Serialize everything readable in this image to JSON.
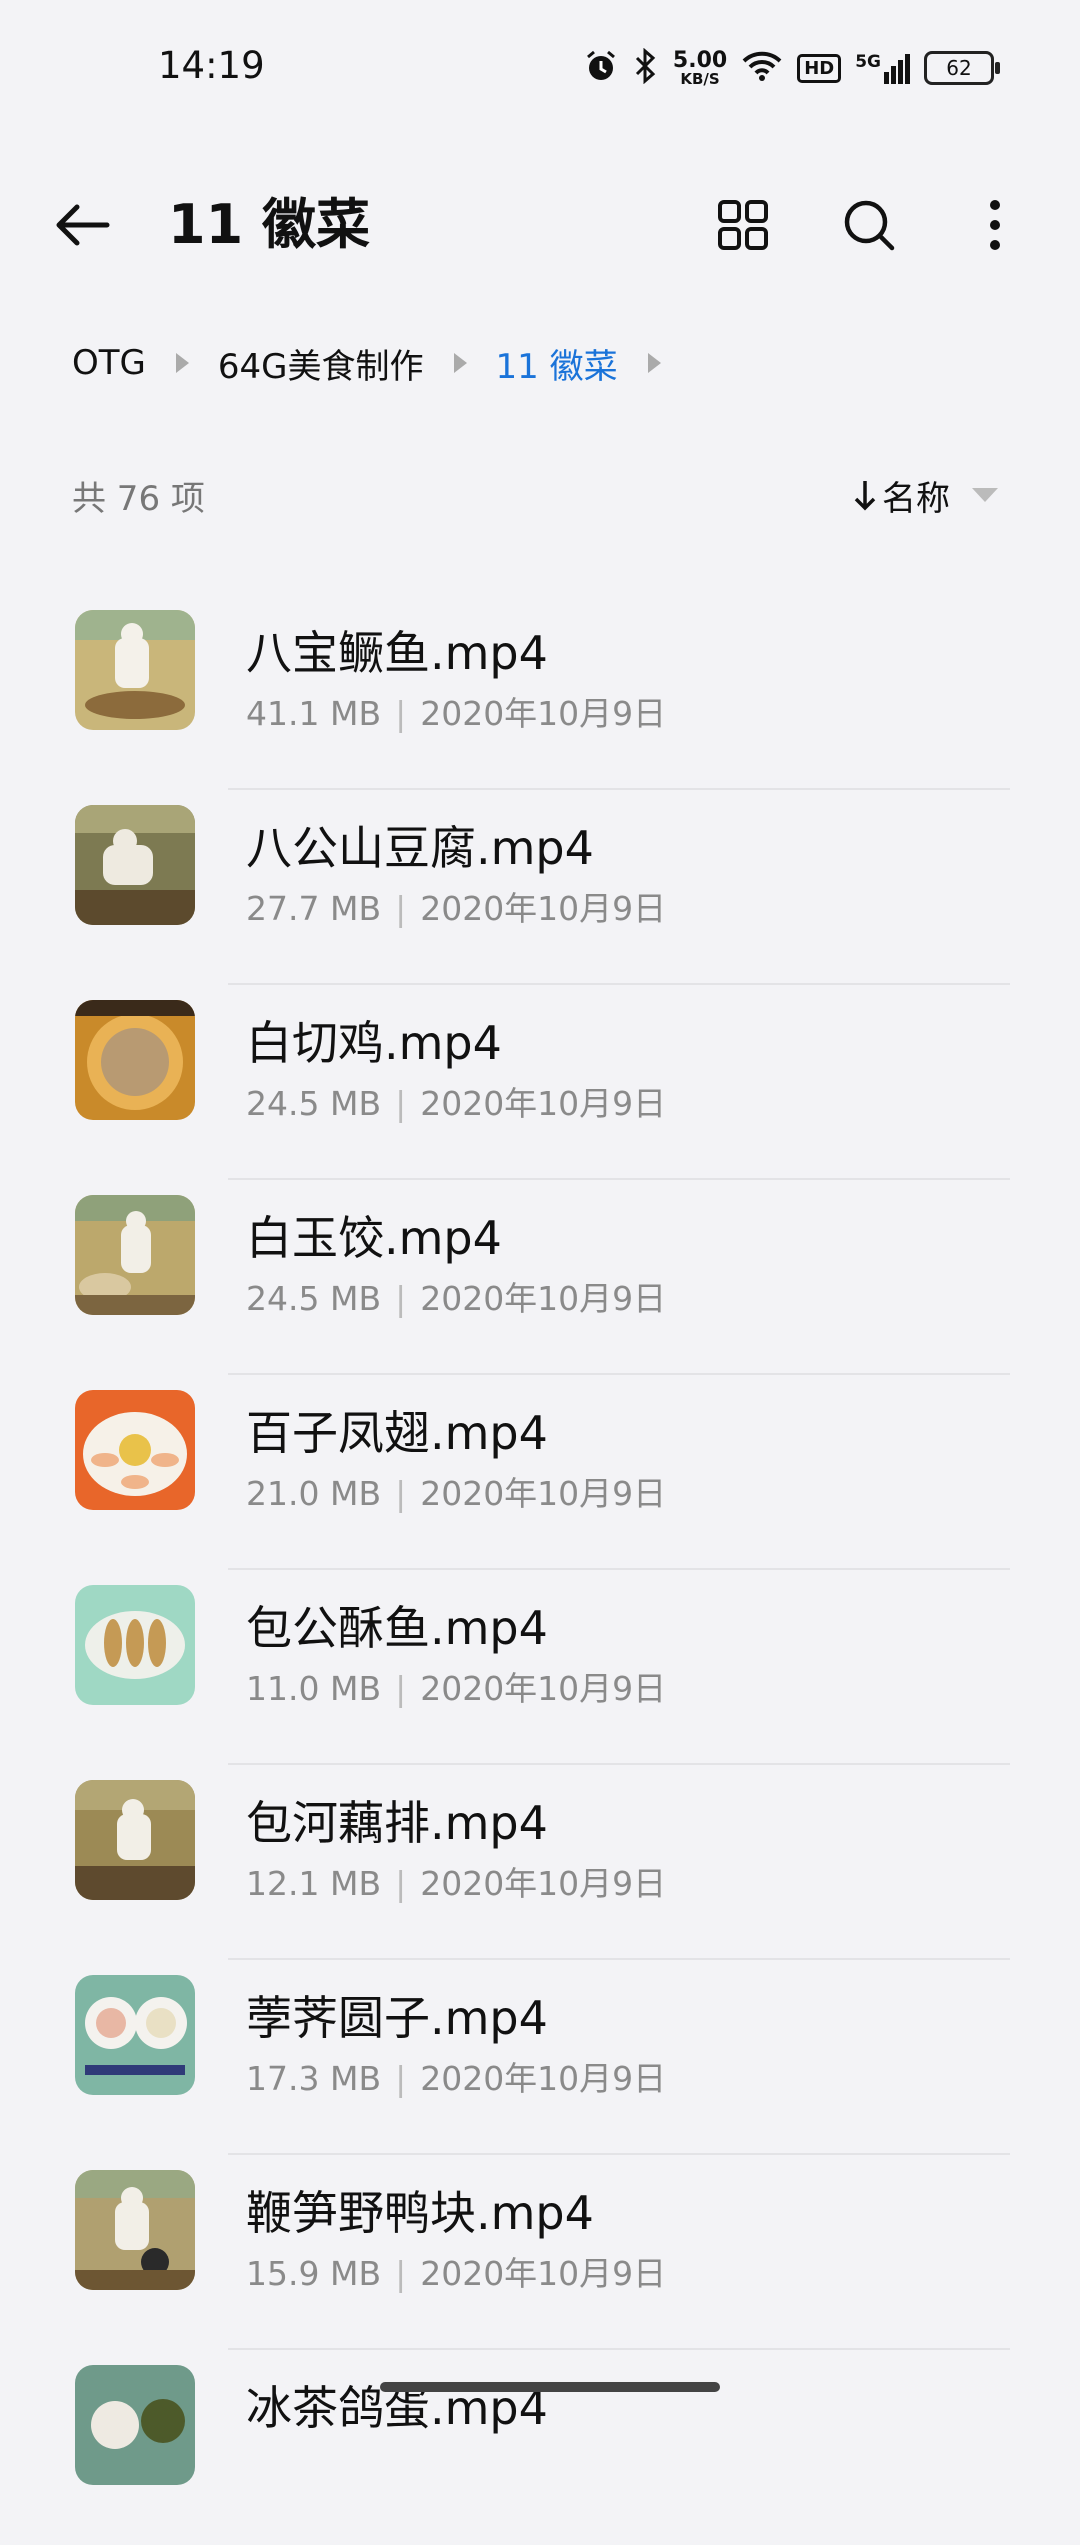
{
  "status_bar": {
    "time": "14:19",
    "net_speed": "5.00",
    "net_unit": "KB/S",
    "hd": "HD",
    "signal": "5G",
    "battery": "62",
    "icons": [
      "alarm-icon",
      "bluetooth-icon",
      "wifi-icon",
      "signal-icon",
      "battery-icon"
    ]
  },
  "app_bar": {
    "title": "11 徽菜",
    "icons": [
      "back-arrow-icon",
      "grid-view-icon",
      "search-icon",
      "more-vertical-icon"
    ]
  },
  "breadcrumb": [
    "OTG",
    "64G美食制作",
    "11 徽菜"
  ],
  "list_header": {
    "count": "共 76 项",
    "sort_label": "名称"
  },
  "files": [
    {
      "name": "八宝鳜鱼.mp4",
      "size": "41.1 MB",
      "date": "2020年10月9日"
    },
    {
      "name": "八公山豆腐.mp4",
      "size": "27.7 MB",
      "date": "2020年10月9日"
    },
    {
      "name": "白切鸡.mp4",
      "size": "24.5 MB",
      "date": "2020年10月9日"
    },
    {
      "name": "白玉饺.mp4",
      "size": "24.5 MB",
      "date": "2020年10月9日"
    },
    {
      "name": "百子凤翅.mp4",
      "size": "21.0 MB",
      "date": "2020年10月9日"
    },
    {
      "name": "包公酥鱼.mp4",
      "size": "11.0 MB",
      "date": "2020年10月9日"
    },
    {
      "name": "包河藕排.mp4",
      "size": "12.1 MB",
      "date": "2020年10月9日"
    },
    {
      "name": "荸荠圆子.mp4",
      "size": "17.3 MB",
      "date": "2020年10月9日"
    },
    {
      "name": "鞭笋野鸭块.mp4",
      "size": "15.9 MB",
      "date": "2020年10月9日"
    },
    {
      "name": "冰茶鸽蛋.mp4",
      "size": "",
      "date": ""
    }
  ],
  "colors": {
    "background": "#f3f3f6",
    "accent": "#1a73d9",
    "secondary_text": "#8a8a8a"
  }
}
